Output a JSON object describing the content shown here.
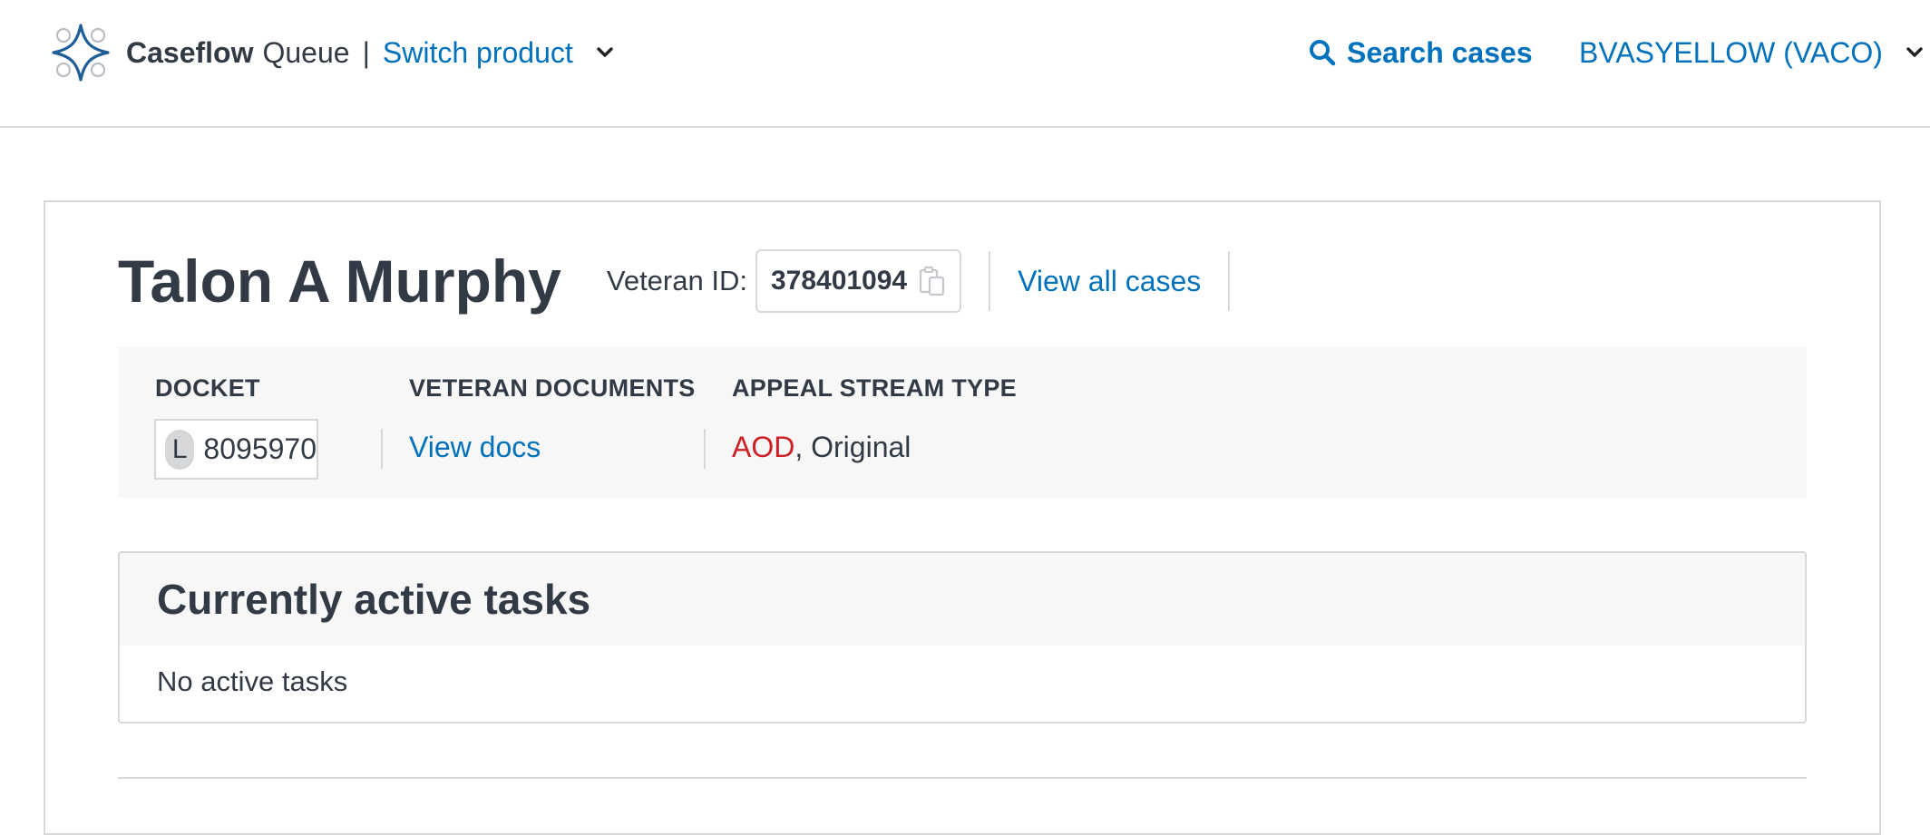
{
  "header": {
    "app_name": "Caseflow",
    "product_name": "Queue",
    "separator": "|",
    "switch_product_label": "Switch product",
    "search_label": "Search cases",
    "user_label": "BVASYELLOW (VACO)",
    "icons": {
      "logo": "caseflow-logo-icon",
      "switch_chevron": "chevron-down-icon",
      "search": "search-icon",
      "user_chevron": "chevron-down-icon"
    }
  },
  "case": {
    "veteran_name": "Talon A Murphy",
    "veteran_id_label": "Veteran ID:",
    "veteran_id": "378401094",
    "view_all_cases_label": "View all cases"
  },
  "summary": {
    "docket_label": "DOCKET",
    "docket_type": "L",
    "docket_number": "8095970",
    "documents_label": "VETERAN DOCUMENTS",
    "view_docs_label": "View docs",
    "stream_label": "APPEAL STREAM TYPE",
    "stream_aod": "AOD",
    "stream_rest": ", Original"
  },
  "tasks": {
    "heading": "Currently active tasks",
    "empty_text": "No active tasks"
  },
  "colors": {
    "link": "#0071bc",
    "text": "#323a45",
    "aod": "#cd2026",
    "border": "#d6d7d9",
    "panel": "#f7f7f7"
  }
}
